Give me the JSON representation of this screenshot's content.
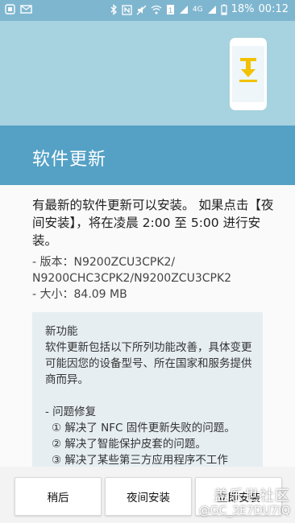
{
  "status_bar": {
    "signal_label": "4G",
    "battery": "18%",
    "time": "00:12",
    "sim_badge": "1"
  },
  "header": {
    "title": "软件更新"
  },
  "content": {
    "intro": "有最新的软件更新可以安装。 如果点击【夜间安装】，将在凌晨 2:00 至 5:00 进行安装。",
    "version_line1": "- 版本：N9200ZCU3CPK2/",
    "version_line2": "N9200CHC3CPK2/N9200ZCU3CPK2",
    "size": "- 大小：84.09 MB",
    "features": {
      "title": "新功能",
      "summary": "软件更新包括以下所列功能改善，具体变更可能因您的设备型号、所在国家和服务提供商而异。",
      "section": "- 问题修复",
      "items": [
        "① 解决了 NFC 固件更新失败的问题。",
        "② 解决了智能保护皮套的问题。",
        "③ 解决了某些第三方应用程序不工作"
      ]
    }
  },
  "buttons": {
    "later": "稍后",
    "night_install": "夜间安装",
    "install_now": "立即安装"
  },
  "watermark": {
    "brand": "盖乐世社区",
    "handle": "@GC_3E7DU7IQ"
  },
  "colors": {
    "status_bar": "#7fb6cf",
    "hero": "#a7d2df",
    "title_band": "#55a1c6",
    "download_arrow": "#f2c200"
  }
}
